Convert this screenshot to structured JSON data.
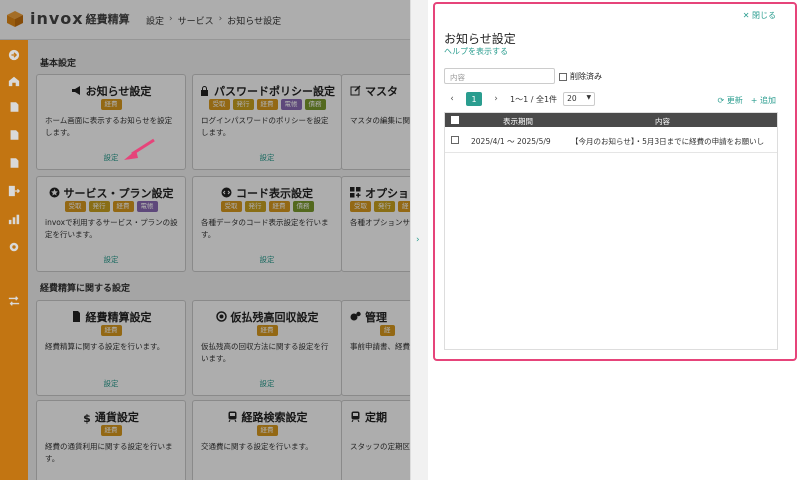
{
  "app": {
    "logo_text": "invox",
    "logo_sub": "経費精算"
  },
  "breadcrumb": [
    "設定",
    "サービス",
    "お知らせ設定"
  ],
  "sections": {
    "basic": "基本設定",
    "expense": "経費精算に関する設定"
  },
  "cards": [
    {
      "title": "お知らせ設定",
      "tags": [
        "経費"
      ],
      "desc": "ホーム画面に表示するお知らせを設定します。",
      "link": "設定"
    },
    {
      "title": "パスワードポリシー設定",
      "tags": [
        "受取",
        "発行",
        "経費",
        "電帳",
        "債務"
      ],
      "desc": "ログインパスワードのポリシーを設定します。",
      "link": "設定"
    },
    {
      "title": "マスタ",
      "tags": [],
      "desc": "マスタの編集に関",
      "link": ""
    },
    {
      "title": "サービス・プラン設定",
      "tags": [
        "受取",
        "発行",
        "経費",
        "電帳"
      ],
      "desc": "invoxで利用するサービス・プランの設定を行います。",
      "link": "設定"
    },
    {
      "title": "コード表示設定",
      "tags": [
        "受取",
        "発行",
        "経費",
        "債務"
      ],
      "desc": "各種データのコード表示設定を行います。",
      "link": "設定"
    },
    {
      "title": "オプション",
      "tags": [
        "受取",
        "発行",
        "経"
      ],
      "desc": "各種オプションサ",
      "link": ""
    },
    {
      "title": "経費精算設定",
      "tags": [
        "経費"
      ],
      "desc": "経費精算に関する設定を行います。",
      "link": "設定"
    },
    {
      "title": "仮払残高回収設定",
      "tags": [
        "経費"
      ],
      "desc": "仮払残高の回収方法に関する設定を行います。",
      "link": "設定"
    },
    {
      "title": "管理",
      "tags": [
        "経"
      ],
      "desc": "事前申請書、経費精算に関する項目を",
      "link": ""
    },
    {
      "title": "通貨設定",
      "tags": [
        "経費"
      ],
      "desc": "経費の通貨利用に関する設定を行います。",
      "link": ""
    },
    {
      "title": "経路検索設定",
      "tags": [
        "経費"
      ],
      "desc": "交通費に関する設定を行います。",
      "link": ""
    },
    {
      "title": "定期",
      "tags": [],
      "desc": "スタッフの定期区間",
      "link": ""
    }
  ],
  "panel": {
    "close_label": "閉じる",
    "title": "お知らせ設定",
    "help_link": "ヘルプを表示する",
    "search_placeholder": "内容",
    "deleted_label": "削除済み",
    "page_current": "1",
    "page_range": "1〜1 / 全1件",
    "page_size": "20",
    "refresh_label": "更新",
    "add_label": "追加",
    "columns": [
      "表示期間",
      "内容"
    ],
    "rows": [
      {
        "period": "2025/4/1 〜 2025/5/9",
        "content": "【今月のお知らせ】・5月3日までに経費の申請をお願いし"
      }
    ]
  },
  "colors": {
    "accent": "#2a9d8f",
    "rail": "#e48a16",
    "highlight": "#e6447a"
  }
}
